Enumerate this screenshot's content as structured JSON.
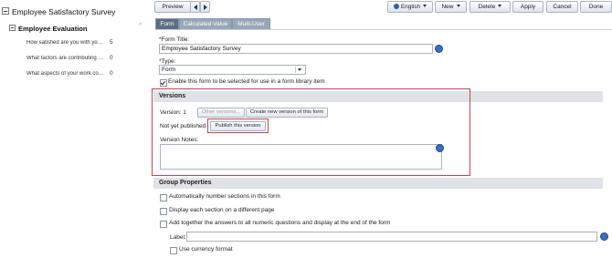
{
  "tree": {
    "root": "Employee Satisfactory Survey",
    "section": "Employee Evaluation",
    "questions": [
      {
        "label": "How satisfied are you with your...",
        "count": "5"
      },
      {
        "label": "What factors are contributing to...",
        "count": "0"
      },
      {
        "label": "What aspects of your work contr...",
        "count": "0"
      }
    ]
  },
  "toolbar": {
    "preview": "Preview",
    "language": "English",
    "new": "New",
    "delete": "Delete",
    "apply": "Apply",
    "cancel": "Cancel",
    "done": "Done"
  },
  "tabs": [
    "Form",
    "Calculated Value",
    "Multi-User"
  ],
  "form": {
    "title_label": "*Form Title:",
    "title_value": "Employee Satisfactory Survey",
    "type_label": "*Type:",
    "type_value": "Form",
    "enable_label": "Enable this form to be selected for use in a form library item",
    "enable_checked": true
  },
  "versions": {
    "header": "Versions",
    "version_label": "Version: 1",
    "other_versions": "Other versions...",
    "create_new": "Create new version of this form",
    "not_published": "Not yet published",
    "publish": "Publish this version",
    "notes_label": "Version Notes:",
    "notes_value": ""
  },
  "group": {
    "header": "Group Properties",
    "opt1": "Automatically number sections in this form",
    "opt2": "Display each section on a different page",
    "opt3": "Add together the answers to all numeric questions and display at the end of the form",
    "label_field": "Label:",
    "currency": "Use currency format"
  },
  "colors": {
    "highlight": "#c9444a",
    "accent": "#3a6fc0",
    "section_bg": "#dfe2e7",
    "active_tab": "#5c6f87"
  }
}
